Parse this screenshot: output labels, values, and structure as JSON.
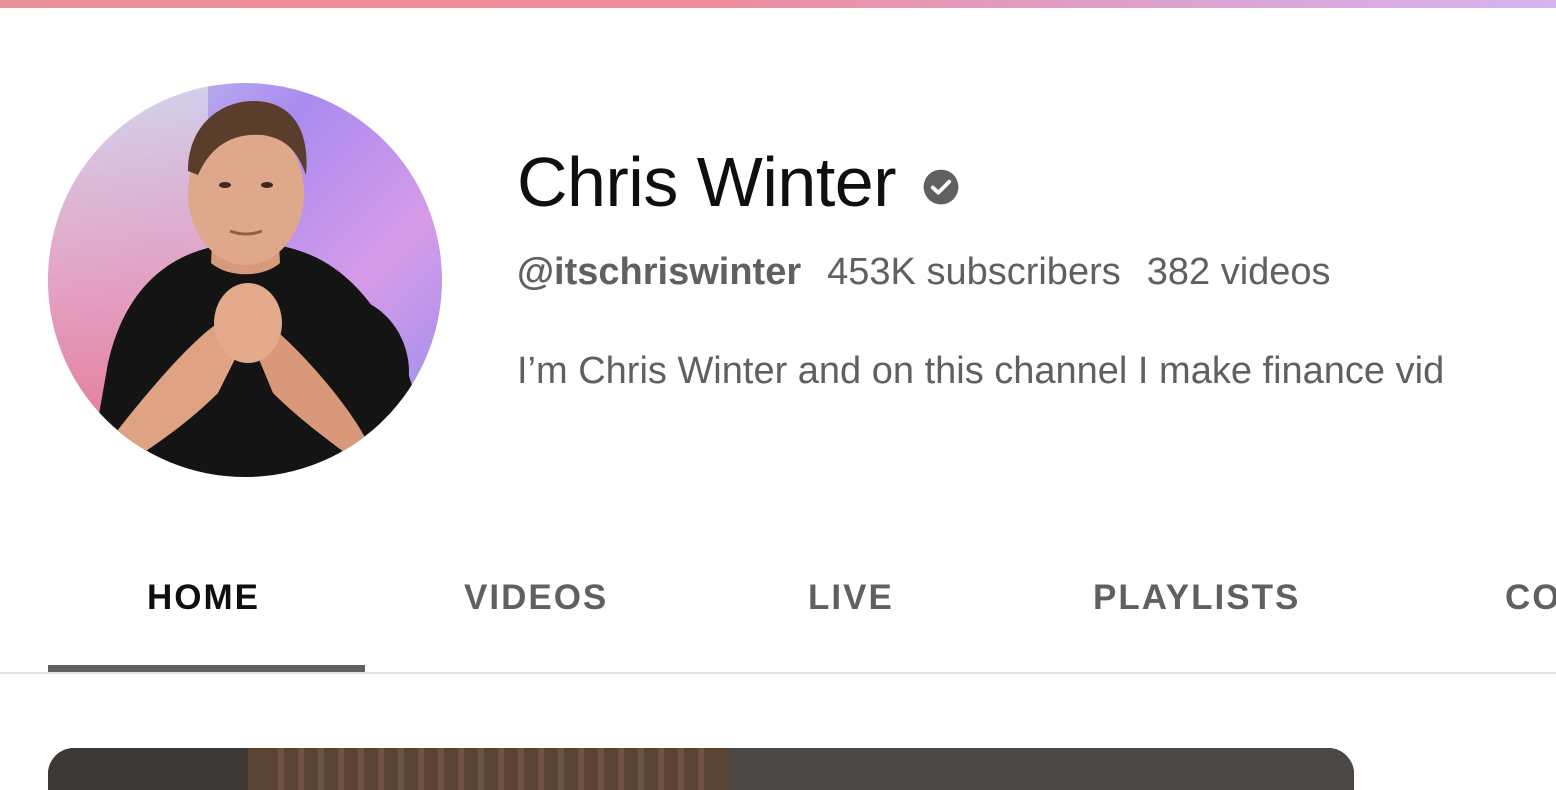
{
  "channel": {
    "name": "Chris Winter",
    "handle": "@itschriswinter",
    "subscribers": "453K subscribers",
    "videos": "382 videos",
    "description": "I’m Chris Winter and on this channel I make finance vid",
    "verified_icon": "verified-check-icon",
    "avatar": "channel-avatar"
  },
  "tabs": [
    {
      "label": "HOME",
      "active": true
    },
    {
      "label": "VIDEOS",
      "active": false
    },
    {
      "label": "LIVE",
      "active": false
    },
    {
      "label": "PLAYLISTS",
      "active": false
    },
    {
      "label": "CO",
      "active": false
    }
  ],
  "colors": {
    "text_primary": "#0f0f0f",
    "text_secondary": "#606060",
    "banner_start": "#e98f97",
    "banner_end": "#d6b4ee",
    "divider": "#e5e5e5"
  }
}
